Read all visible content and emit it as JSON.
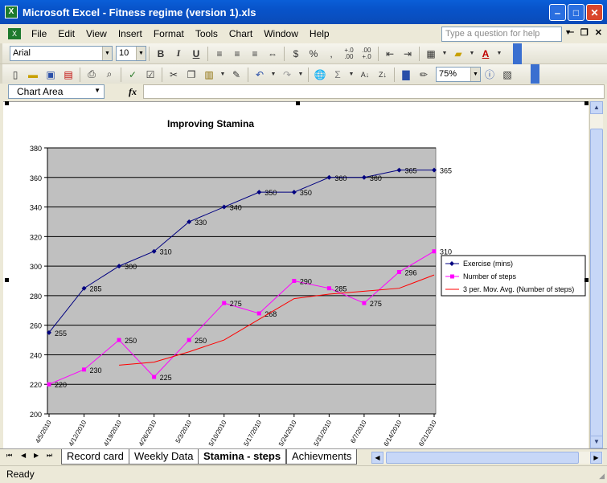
{
  "window": {
    "title": "Microsoft Excel - Fitness regime (version 1).xls"
  },
  "menu": [
    "File",
    "Edit",
    "View",
    "Insert",
    "Format",
    "Tools",
    "Chart",
    "Window",
    "Help"
  ],
  "help_box": {
    "placeholder": "Type a question for help"
  },
  "formatting": {
    "font": "Arial",
    "size": "10",
    "bold": "B",
    "italic": "I",
    "underline": "U",
    "currency": "$",
    "percent": "%",
    "comma": ",",
    "inc_decimal": "+.0\n.00",
    "dec_decimal": ".00\n+.0"
  },
  "standard": {
    "zoom": "75%"
  },
  "formula_bar": {
    "name_box": "Chart Area",
    "fx": "fx",
    "value": ""
  },
  "sheets": {
    "tabs": [
      "Record card",
      "Weekly Data",
      "Stamina - steps",
      "Achievments"
    ],
    "active": 2
  },
  "status": {
    "text": "Ready"
  },
  "colors": {
    "plot_bg": "#c0c0c0",
    "exercise": "#000080",
    "steps": "#ff00ff",
    "moving_avg": "#ff0000"
  },
  "chart_data": {
    "type": "line",
    "title": "Improving Stamina",
    "categories": [
      "4/5/2010",
      "4/12/2010",
      "4/19/2010",
      "4/26/2010",
      "5/3/2010",
      "5/10/2010",
      "5/17/2010",
      "5/24/2010",
      "5/31/2010",
      "6/7/2010",
      "6/14/2010",
      "6/21/2010"
    ],
    "ylim": [
      200,
      380
    ],
    "y_ticks": [
      200,
      220,
      240,
      260,
      280,
      300,
      320,
      340,
      360,
      380
    ],
    "grid": "horizontal",
    "legend": "right",
    "series": [
      {
        "name": "Exercise (mins)",
        "values": [
          255,
          285,
          300,
          310,
          330,
          340,
          350,
          350,
          360,
          360,
          365,
          365
        ],
        "marker": "diamond",
        "data_labels": true
      },
      {
        "name": "Number of steps",
        "values": [
          220,
          230,
          250,
          225,
          250,
          275,
          268,
          290,
          285,
          275,
          296,
          310
        ],
        "marker": "square",
        "data_labels": true
      },
      {
        "name": "3 per. Mov. Avg. (Number of steps)",
        "values": [
          null,
          null,
          233,
          235,
          242,
          250,
          264,
          278,
          281,
          283,
          285,
          294
        ],
        "marker": "none",
        "data_labels": false
      }
    ]
  }
}
